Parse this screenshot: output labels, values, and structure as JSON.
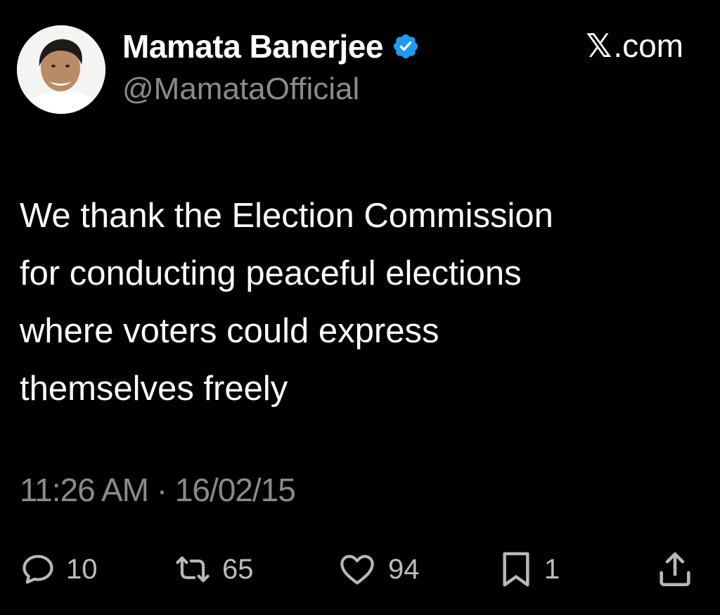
{
  "author": {
    "display_name": "Mamata Banerjee",
    "handle": "@MamataOfficial",
    "verified": true,
    "verified_color": "#1d9bf0"
  },
  "brand": {
    "glyph": "𝕏",
    "label": ".com"
  },
  "tweet": {
    "lines": [
      "We thank the Election Commission",
      "for conducting peaceful elections",
      "where voters could express",
      "themselves freely"
    ],
    "timestamp": "11:26 AM · 16/02/15"
  },
  "actions": {
    "reply": {
      "icon": "reply-icon",
      "count": "10"
    },
    "retweet": {
      "icon": "retweet-icon",
      "count": "65"
    },
    "like": {
      "icon": "heart-icon",
      "count": "94"
    },
    "bookmark": {
      "icon": "bookmark-icon",
      "count": "1"
    },
    "share": {
      "icon": "share-icon"
    }
  },
  "colors": {
    "background": "#000000",
    "text": "#ffffff",
    "secondary_text": "#8b8b8b",
    "icon": "#b9b9b9"
  }
}
